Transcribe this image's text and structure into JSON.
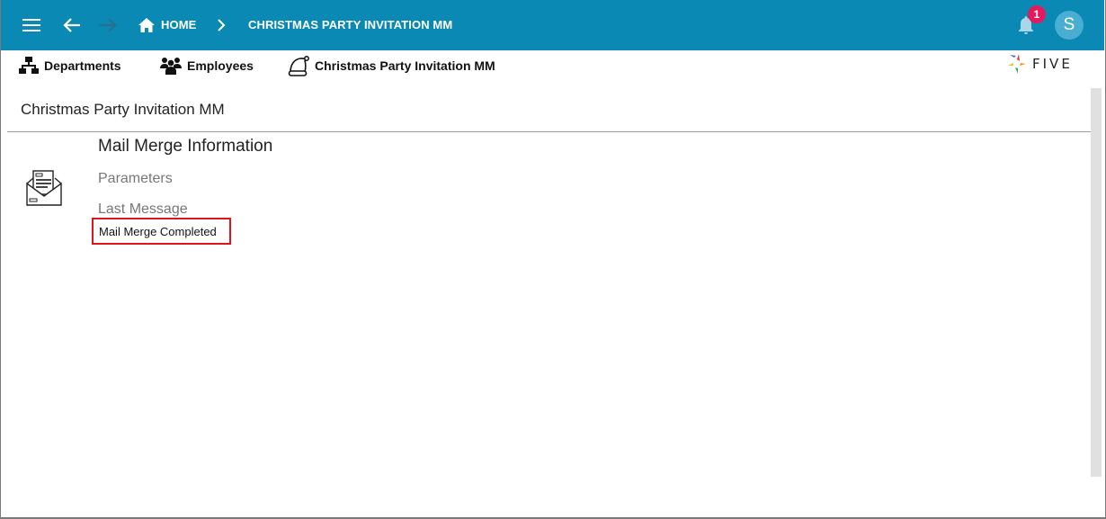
{
  "appbar": {
    "menu_icon": "hamburger-menu-icon",
    "back_icon": "arrow-left-icon",
    "forward_icon": "arrow-right-icon",
    "home_icon": "home-icon",
    "home_label": "HOME",
    "separator_icon": "chevron-right-icon",
    "current_label": "CHRISTMAS PARTY INVITATION MM",
    "notifications_icon": "bell-icon",
    "notification_count": "1",
    "avatar_initial": "S",
    "colors": {
      "bar": "#0b89b5",
      "badge": "#e5195e",
      "avatar": "#4aaed3"
    }
  },
  "menu": {
    "items": [
      {
        "label": "Departments",
        "icon": "org-chart-icon"
      },
      {
        "label": "Employees",
        "icon": "people-group-icon"
      },
      {
        "label": "Christmas Party Invitation MM",
        "icon": "santa-hat-icon"
      }
    ]
  },
  "logo": {
    "text": "FIVE"
  },
  "page": {
    "title": "Christmas Party Invitation MM",
    "section_title": "Mail Merge Information",
    "icon": "open-envelope-letter-icon",
    "fields": {
      "parameters_label": "Parameters",
      "last_message_label": "Last Message",
      "last_message_value": "Mail Merge Completed"
    },
    "highlight_color": "#e0141e"
  }
}
